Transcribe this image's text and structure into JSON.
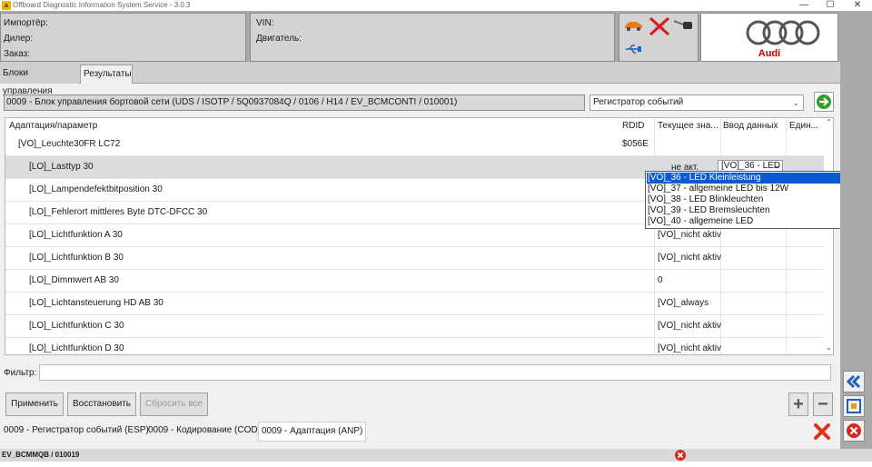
{
  "window": {
    "title": "Offboard Diagnostic Information System Service - 3.0.3",
    "minimize": "—",
    "maximize": "☐",
    "close": "✕"
  },
  "info": {
    "importer_label": "Импортёр:",
    "dealer_label": "Дилер:",
    "order_label": "Заказ:",
    "vin_label": "VIN:",
    "engine_label": "Двигатель:"
  },
  "logo": {
    "text": "Audi",
    "icon": "four-rings-logo"
  },
  "tabs": [
    {
      "label": "Блоки управления"
    },
    {
      "label": "Результаты"
    }
  ],
  "ecu": {
    "label": "0009 - Блок управления бортовой сети  (UDS / ISOTP / 5Q0937084Q  / 0106 / H14 / EV_BCMCONTI / 010001)"
  },
  "mode_select": {
    "value": "Регистратор событий"
  },
  "table": {
    "headers": [
      "Адаптация/параметр",
      "RDID",
      "Текущее зна...",
      "Ввод данных",
      "Един..."
    ],
    "rows": [
      {
        "param": "[VO]_Leuchte30FR LC72",
        "rdid": "$056E",
        "current": "",
        "input": ""
      },
      {
        "param": "[LO]_Lasttyp 30",
        "rdid": "",
        "current": "не акт.",
        "input": "[VO]_36 - LED"
      },
      {
        "param": "[LO]_Lampendefektbitposition 30",
        "rdid": "",
        "current": "",
        "input": ""
      },
      {
        "param": "[LO]_Fehlerort mittleres Byte DTC-DFCC 30",
        "rdid": "",
        "current": "",
        "input": ""
      },
      {
        "param": "[LO]_Lichtfunktion A 30",
        "rdid": "",
        "current": "[VO]_nicht aktiv",
        "input": ""
      },
      {
        "param": "[LO]_Lichtfunktion B 30",
        "rdid": "",
        "current": "[VO]_nicht aktiv",
        "input": ""
      },
      {
        "param": "[LO]_Dimmwert AB 30",
        "rdid": "",
        "current": "0",
        "input": ""
      },
      {
        "param": "[LO]_Lichtansteuerung HD AB 30",
        "rdid": "",
        "current": "[VO]_always",
        "input": ""
      },
      {
        "param": "[LO]_Lichtfunktion C 30",
        "rdid": "",
        "current": "[VO]_nicht aktiv",
        "input": ""
      },
      {
        "param": "[LO]_Lichtfunktion D 30",
        "rdid": "",
        "current": "[VO]_nicht aktiv",
        "input": ""
      }
    ]
  },
  "dropdown": {
    "options": [
      "[VO]_36 - LED Kleinleistung",
      "[VO]_37 - allgemeine LED bis 12W",
      "[VO]_38 - LED Blinkleuchten",
      "[VO]_39 - LED Bremsleuchten",
      "[VO]_40 - allgemeine LED"
    ],
    "highlight_color": "#0a5ad1"
  },
  "filter": {
    "label": "Фильтр:",
    "value": ""
  },
  "buttons": {
    "apply": "Применить",
    "restore": "Восстановить",
    "reset_all": "Сбросить все",
    "plus": "+",
    "minus": "−"
  },
  "breadcrumbs": [
    "0009 - Регистратор событий (ESP)",
    "0009 - Кодирование (COD)",
    "0009 - Адаптация (ANP)"
  ],
  "status": {
    "text": "EV_BCMMQB / 010019"
  }
}
